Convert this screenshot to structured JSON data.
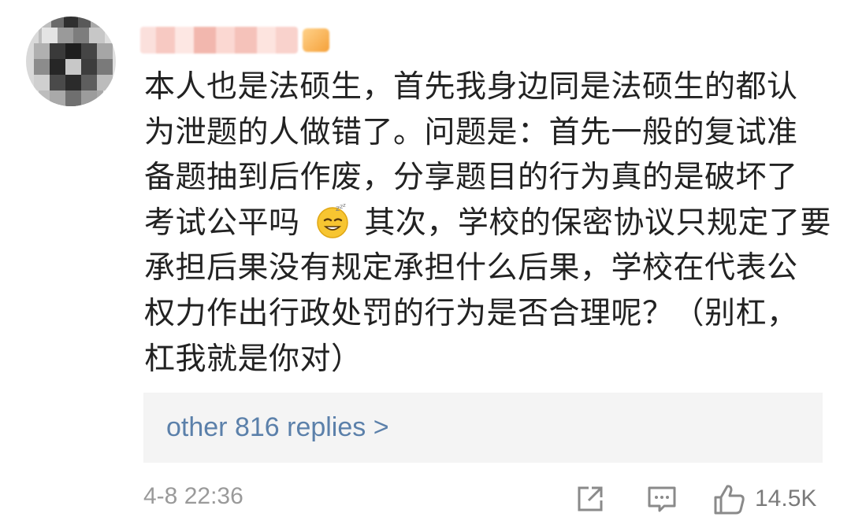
{
  "comment": {
    "lines": [
      "本人也是法硕生，首先我身边同是法硕生的都认",
      "为泄题的人做错了。问题是：首先一般的复试准",
      "备题抽到后作废，分享题目的行为真的是破坏了",
      "考试公平吗",
      "其次，学校的保密协议只规定了要",
      "承担后果没有规定承担什么后果，学校在代表公",
      "权力作出行政处罚的行为是否合理呢？（别杠，",
      "杠我就是你对）"
    ],
    "emoji": "sweat-smile-emoji"
  },
  "replies": {
    "label": "other 816 replies >"
  },
  "footer": {
    "timestamp": "4-8 22:36",
    "like_count": "14.5K",
    "icons": {
      "share": "share-icon",
      "comment": "comment-icon",
      "like": "thumbs-up-icon"
    }
  },
  "colors": {
    "link": "#5b80aa",
    "text": "#222222",
    "meta": "#9a9a9a",
    "reply_bg": "#f4f4f4"
  }
}
